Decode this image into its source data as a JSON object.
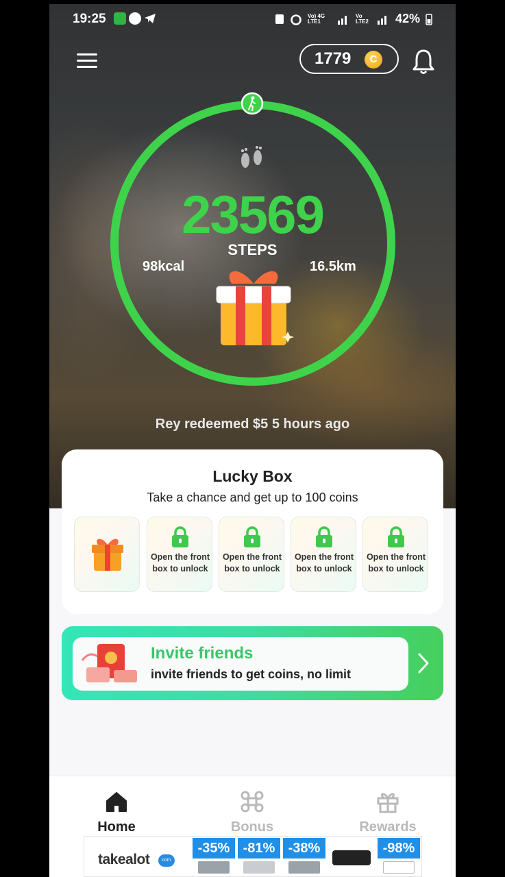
{
  "status_bar": {
    "time": "19:25",
    "carrier_1": "Vo) 4G LTE1",
    "carrier_2": "Vo LTE2",
    "battery": "42%"
  },
  "header": {
    "coins": "1779",
    "coin_symbol": "C"
  },
  "steps": {
    "count": "23569",
    "label": "STEPS",
    "calories": "98kcal",
    "distance": "16.5km",
    "ring_progress": 1.0
  },
  "ticker": "Rey redeemed $5 5 hours ago",
  "lucky_box": {
    "title": "Lucky Box",
    "subtitle": "Take a chance and get up to 100 coins",
    "locked_text": "Open the front box to unlock",
    "boxes": [
      {
        "state": "open"
      },
      {
        "state": "locked"
      },
      {
        "state": "locked"
      },
      {
        "state": "locked"
      },
      {
        "state": "locked"
      }
    ]
  },
  "invite": {
    "title": "Invite friends",
    "subtitle": "invite friends to get coins, no limit"
  },
  "nav": {
    "home": "Home",
    "bonus": "Bonus",
    "rewards": "Rewards"
  },
  "ad": {
    "brand": "takealot",
    "brand_badge": "com",
    "deals": [
      "-35%",
      "-81%",
      "-38%",
      "-98%"
    ]
  },
  "colors": {
    "ring_green": "#3ed34a",
    "accent_green": "#3ac66a",
    "coin_gold": "#e9a414",
    "deal_blue": "#1f8fe8"
  }
}
